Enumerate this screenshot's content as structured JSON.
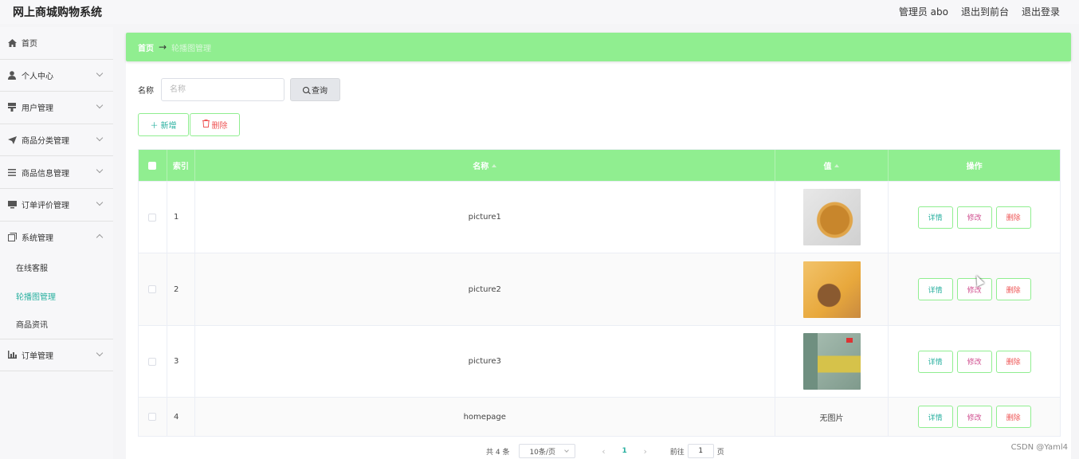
{
  "header": {
    "app_title": "网上商城购物系统",
    "admin_label": "管理员 abo",
    "exit_front": "退出到前台",
    "logout": "退出登录"
  },
  "sidebar": {
    "items": [
      {
        "label": "首页",
        "icon": "home-icon"
      },
      {
        "label": "个人中心",
        "icon": "user-icon"
      },
      {
        "label": "用户管理",
        "icon": "users-icon"
      },
      {
        "label": "商品分类管理",
        "icon": "send-icon"
      },
      {
        "label": "商品信息管理",
        "icon": "list-icon"
      },
      {
        "label": "订单评价管理",
        "icon": "monitor-icon"
      },
      {
        "label": "系统管理",
        "icon": "copy-icon"
      },
      {
        "label": "订单管理",
        "icon": "chart-icon"
      }
    ],
    "system_sub": [
      {
        "label": "在线客服"
      },
      {
        "label": "轮播图管理"
      },
      {
        "label": "商品资讯"
      }
    ]
  },
  "breadcrumb": {
    "home": "首页",
    "arrow": "→",
    "current": "轮播图管理"
  },
  "search": {
    "label": "名称",
    "placeholder": "名称",
    "button": "查询"
  },
  "actions": {
    "add": "新增",
    "delete": "删除"
  },
  "table": {
    "headers": {
      "index": "索引",
      "name": "名称",
      "value": "值",
      "ops": "操作"
    },
    "rows": [
      {
        "index": "1",
        "name": "picture1",
        "value": ""
      },
      {
        "index": "2",
        "name": "picture2",
        "value": ""
      },
      {
        "index": "3",
        "name": "picture3",
        "value": ""
      },
      {
        "index": "4",
        "name": "homepage",
        "value": "无图片"
      }
    ],
    "op_labels": {
      "detail": "详情",
      "edit": "修改",
      "delete": "删除"
    }
  },
  "pagination": {
    "total": "共 4 条",
    "page_size": "10条/页",
    "prev": "‹",
    "current": "1",
    "next": "›",
    "goto": "前往",
    "goto_value": "1",
    "unit": "页"
  },
  "watermark": "CSDN @Yaml4",
  "colors": {
    "accent_green": "#90ee90",
    "link_teal": "#2ab0a0",
    "edit_pink": "#d05090",
    "delete_red": "#ee5555"
  }
}
